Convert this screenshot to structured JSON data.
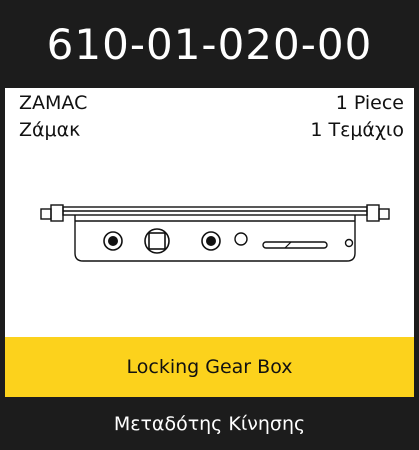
{
  "product": {
    "code": "610-01-020-00",
    "material_en": "ZAMAC",
    "material_gr": "Ζάμακ",
    "quantity_en": "1 Piece",
    "quantity_gr": "1 Τεμάχιο",
    "name_en": "Locking Gear Box",
    "name_gr": "Μεταδότης Κίνησης"
  },
  "colors": {
    "dark": "#1c1c1c",
    "accent_yellow": "#fcd21c",
    "background": "#ffffff"
  },
  "icons": {
    "product_drawing": "gear-box-drawing-icon"
  }
}
